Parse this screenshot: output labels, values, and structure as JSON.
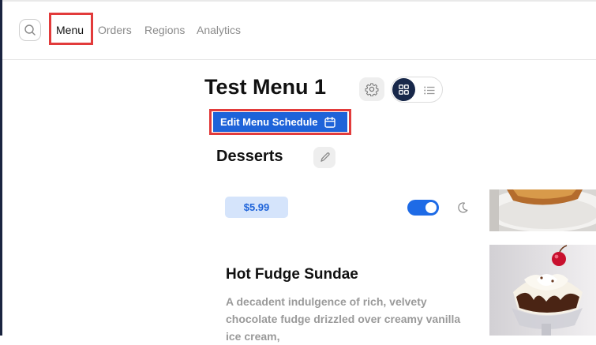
{
  "nav": {
    "links": [
      {
        "label": "Menu",
        "active": true
      },
      {
        "label": "Orders",
        "active": false
      },
      {
        "label": "Regions",
        "active": false
      },
      {
        "label": "Analytics",
        "active": false
      }
    ]
  },
  "menu": {
    "title": "Test Menu 1",
    "edit_schedule_label": "Edit Menu Schedule",
    "view_mode": "grid"
  },
  "section": {
    "title": "Desserts",
    "items": [
      {
        "price": "$5.99",
        "available": true,
        "image_icon": "pie-slice-image"
      },
      {
        "name": "Hot Fudge Sundae",
        "description": "A decadent indulgence of rich, velvety chocolate fudge drizzled over creamy vanilla ice cream,",
        "image_icon": "sundae-image"
      }
    ]
  },
  "colors": {
    "accent": "#1e63d9",
    "nav_dark": "#18284a",
    "highlight": "#e23b3b",
    "price_bg": "#d5e4fb"
  }
}
